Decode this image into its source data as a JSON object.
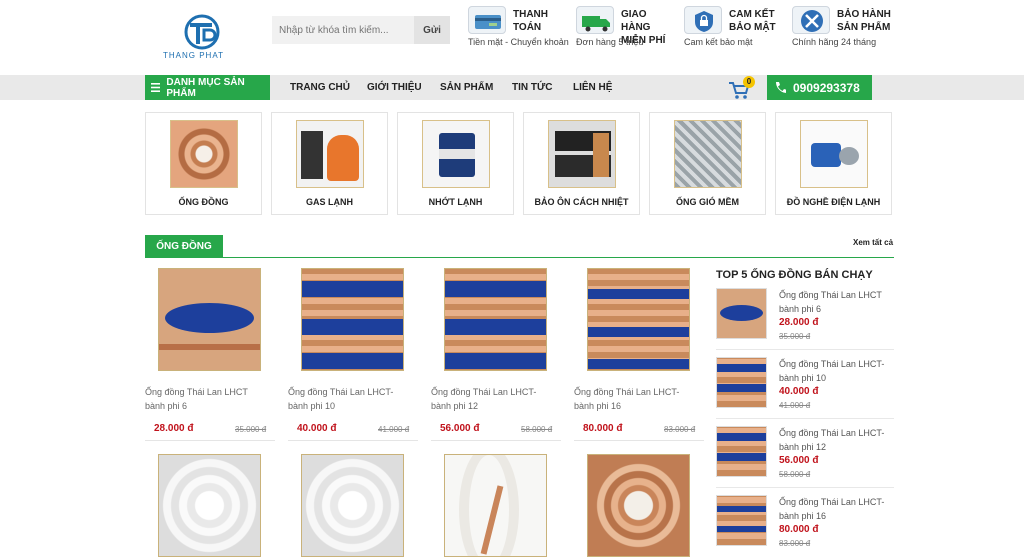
{
  "header": {
    "logo_text": "THANG PHAT",
    "search": {
      "placeholder": "Nhập từ khóa tìm kiếm...",
      "button": "Gửi"
    },
    "features": [
      {
        "icon": "payment-card-icon",
        "title": "THANH\nTOÁN",
        "sub": "Tiền mặt - Chuyển khoản"
      },
      {
        "icon": "delivery-truck-icon",
        "title": "GIAO HÀNG\nMIỄN PHÍ",
        "sub": "Đơn hàng 5 triệu"
      },
      {
        "icon": "shield-lock-icon",
        "title": "CAM KẾT\nBẢO MẬT",
        "sub": "Cam kết bảo mật"
      },
      {
        "icon": "wrench-screwdriver-icon",
        "title": "BẢO HÀNH\nSẢN PHẨM",
        "sub": "Chính hãng 24 tháng"
      }
    ]
  },
  "nav": {
    "category_button": "DANH MỤC SẢN PHẨM",
    "items": [
      "TRANG CHỦ",
      "GIỚI THIỆU",
      "SẢN PHẨM",
      "TIN TỨC",
      "LIÊN HỆ"
    ],
    "cart_count": "0",
    "phone": "0909293378"
  },
  "categories": [
    {
      "label": "ỐNG ĐỒNG",
      "image": "copper-coil"
    },
    {
      "label": "GAS LẠNH",
      "image": "refrigerant-tank"
    },
    {
      "label": "NHỚT LẠNH",
      "image": "oil-can"
    },
    {
      "label": "BẢO ÔN CÁCH NHIỆT",
      "image": "insulation"
    },
    {
      "label": "ỐNG GIÓ MỀM",
      "image": "flexible-duct"
    },
    {
      "label": "ĐỒ NGHỀ ĐIỆN LẠNH",
      "image": "vacuum-pump"
    }
  ],
  "section": {
    "title": "ỐNG ĐỒNG",
    "see_all": "Xem tất cả"
  },
  "products": [
    {
      "name": "Ống đồng Thái Lan LHCT bành phi 6",
      "price": "28.000 đ",
      "old_price": "35.000 đ"
    },
    {
      "name": "Ống đồng Thái Lan LHCT-bành phi 10",
      "price": "40.000 đ",
      "old_price": "41.000 đ"
    },
    {
      "name": "Ống đồng Thái Lan LHCT-bành phi 12",
      "price": "56.000 đ",
      "old_price": "58.000 đ"
    },
    {
      "name": "Ống đồng Thái Lan LHCT-bành phi 16",
      "price": "80.000 đ",
      "old_price": "83.000 đ"
    }
  ],
  "products_row2": [
    {
      "image": "white-coil"
    },
    {
      "image": "white-coil"
    },
    {
      "image": "insulated-pipe"
    },
    {
      "image": "copper-coil-pack"
    }
  ],
  "sidebar": {
    "title": "TOP 5 ỐNG ĐỒNG BÁN CHẠY",
    "items": [
      {
        "name": "Ống đồng Thái Lan LHCT bành phi 6",
        "price": "28.000 đ",
        "old_price": "35.000 đ"
      },
      {
        "name": "Ống đồng Thái Lan LHCT-bành phi 10",
        "price": "40.000 đ",
        "old_price": "41.000 đ"
      },
      {
        "name": "Ống đồng Thái Lan LHCT-bành phi 12",
        "price": "56.000 đ",
        "old_price": "58.000 đ"
      },
      {
        "name": "Ống đồng Thái Lan LHCT-bành phi 16",
        "price": "80.000 đ",
        "old_price": "83.000 đ"
      }
    ]
  },
  "colors": {
    "accent_green": "#27a74a",
    "price_red": "#c0121b",
    "nav_bg": "#e9e9e9"
  }
}
